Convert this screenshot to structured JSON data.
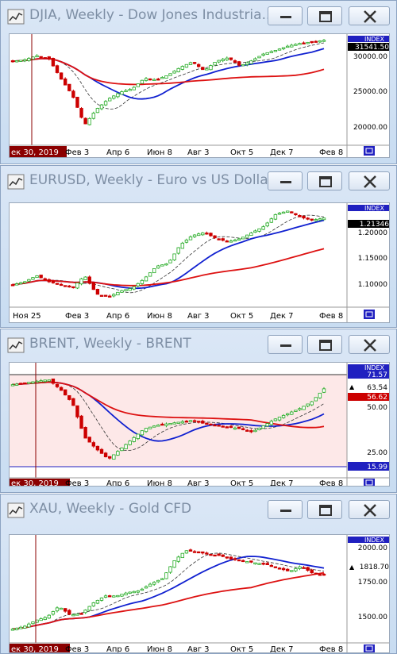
{
  "colors": {
    "up": "#22aa22",
    "down": "#cc0000",
    "ma_blue": "#1020d0",
    "ma_red": "#dd1111",
    "index_bg": "#2020c0",
    "price_bg": "#000000",
    "highlight": "#fde8e8"
  },
  "icons": {
    "app": "chart-icon",
    "min": "minimize-icon",
    "max": "maximize-icon",
    "close": "close-icon",
    "scroll": "scroll-end-icon"
  },
  "windows": [
    {
      "title": "DJIA, Weekly - Dow Jones Industria...",
      "index_label": "INDEX",
      "price_label": "31541.50",
      "y_ticks": [
        "30000.00",
        "25000.00",
        "20000.00"
      ],
      "x_ticks": [
        "Фев 3",
        "Апр 6",
        "Июн 8",
        "Авг 3",
        "Окт 5",
        "Дек 7",
        "Фев 8"
      ],
      "cursor_date": "ек 30, 2019",
      "chart_data": {
        "type": "candlestick",
        "ylim": [
          16500,
          32200
        ],
        "price": 31541.5,
        "anchors": [
          28500,
          28700,
          29300,
          28900,
          26000,
          23500,
          19200,
          21500,
          23000,
          24000,
          24500,
          26000,
          25800,
          26500,
          27600,
          28400,
          27100,
          28500,
          29000,
          27800,
          28600,
          29600,
          30100,
          30700,
          31100,
          31300,
          31541.5
        ],
        "lows": {
          "6": 18300
        }
      }
    },
    {
      "title": "EURUSD, Weekly - Euro vs US Dollar",
      "index_label": "INDEX",
      "price_label": "1.21346",
      "y_ticks": [
        "1.20000",
        "1.15000",
        "1.10000"
      ],
      "x_ticks": [
        "Ноя 25",
        "Фев 3",
        "Апр 6",
        "Июн 8",
        "Авг 3",
        "Окт 5",
        "Дек 7",
        "Фев 8"
      ],
      "chart_data": {
        "type": "candlestick",
        "ylim": [
          1.07,
          1.235
        ],
        "price": 1.21346,
        "anchors": [
          1.105,
          1.11,
          1.12,
          1.11,
          1.105,
          1.1,
          1.12,
          1.09,
          1.085,
          1.095,
          1.1,
          1.115,
          1.135,
          1.14,
          1.17,
          1.185,
          1.19,
          1.18,
          1.175,
          1.18,
          1.19,
          1.2,
          1.22,
          1.225,
          1.215,
          1.21,
          1.21346
        ]
      }
    },
    {
      "title": "BRENT, Weekly - BRENT",
      "index_label": "INDEX",
      "high_label": "71.57",
      "price_label": "63.54",
      "red_label": "56.62",
      "low_label": "15.99",
      "y_ticks": [
        "50.00",
        "25.00"
      ],
      "x_ticks": [
        "Фев 3",
        "Апр 6",
        "Июн 8",
        "Авг 3",
        "Окт 5",
        "Дек 7",
        "Фев 8"
      ],
      "cursor_date": "ек 30, 2019",
      "chart_data": {
        "type": "candlestick",
        "ylim": [
          12,
          78
        ],
        "price": 63.54,
        "anchors": [
          66,
          67,
          68,
          69,
          63,
          55,
          35,
          28,
          22,
          28,
          34,
          40,
          42,
          43,
          44,
          45,
          43,
          42,
          41,
          40,
          38,
          42,
          46,
          49,
          52,
          56,
          63.54
        ]
      }
    },
    {
      "title": "XAU, Weekly - Gold CFD",
      "index_label": "INDEX",
      "price_label": "1818.70",
      "y_ticks": [
        "2000.00",
        "1750.00",
        "1500.00"
      ],
      "x_ticks": [
        "Фев 3",
        "Апр 6",
        "Июн 8",
        "Авг 3",
        "Окт 5",
        "Дек 7",
        "Фев 8"
      ],
      "cursor_date": "ек 30, 2019",
      "chart_data": {
        "type": "candlestick",
        "ylim": [
          1440,
          2040
        ],
        "price": 1818.7,
        "anchors": [
          1510,
          1525,
          1560,
          1580,
          1640,
          1590,
          1600,
          1660,
          1700,
          1700,
          1720,
          1730,
          1770,
          1800,
          1900,
          1960,
          1950,
          1940,
          1930,
          1910,
          1900,
          1890,
          1880,
          1860,
          1840,
          1870,
          1830,
          1818.7
        ]
      }
    }
  ]
}
